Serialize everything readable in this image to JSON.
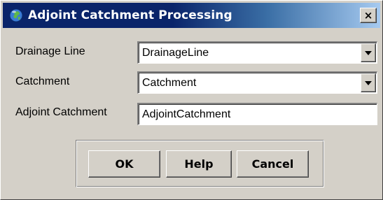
{
  "window": {
    "title": "Adjoint Catchment Processing",
    "title_icon": "globe-icon",
    "close_glyph": "×"
  },
  "form": {
    "drainage_line_label": "Drainage Line",
    "drainage_line_value": "DrainageLine",
    "catchment_label": "Catchment",
    "catchment_value": "Catchment",
    "adjoint_catchment_label": "Adjoint Catchment",
    "adjoint_catchment_value": "AdjointCatchment"
  },
  "buttons": {
    "ok_label": "OK",
    "help_label": "Help",
    "cancel_label": "Cancel"
  },
  "colors": {
    "titlebar_start": "#0a246a",
    "titlebar_end": "#a6caf0",
    "dialog_face": "#d4d0c8"
  }
}
